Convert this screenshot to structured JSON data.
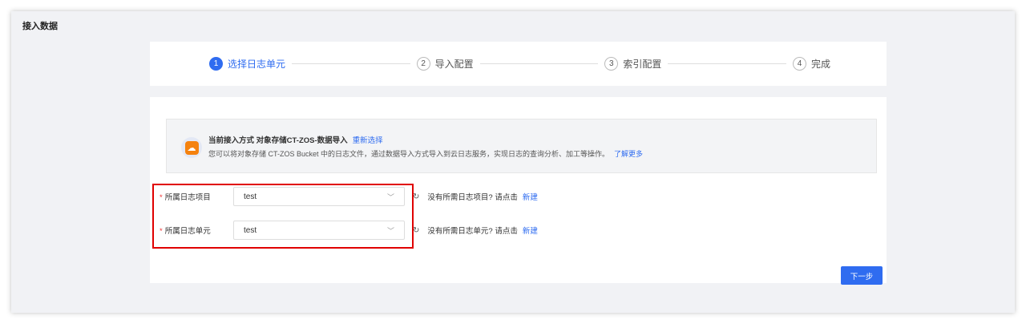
{
  "page_title": "接入数据",
  "steps": [
    {
      "num": "1",
      "label": "选择日志单元"
    },
    {
      "num": "2",
      "label": "导入配置"
    },
    {
      "num": "3",
      "label": "索引配置"
    },
    {
      "num": "4",
      "label": "完成"
    }
  ],
  "info": {
    "prefix": "当前接入方式 对象存储CT-ZOS-数据导入",
    "reselect": "重新选择",
    "desc": "您可以将对象存储 CT-ZOS Bucket 中的日志文件，通过数据导入方式导入到云日志服务，实现日志的查询分析、加工等操作。",
    "learn_more": "了解更多"
  },
  "form": {
    "project": {
      "label": "所属日志项目",
      "value": "test",
      "hint": "没有所需日志项目? 请点击",
      "create": "新建"
    },
    "unit": {
      "label": "所属日志单元",
      "value": "test",
      "hint": "没有所需日志单元? 请点击",
      "create": "新建"
    },
    "required": "*"
  },
  "next_label": "下一步"
}
